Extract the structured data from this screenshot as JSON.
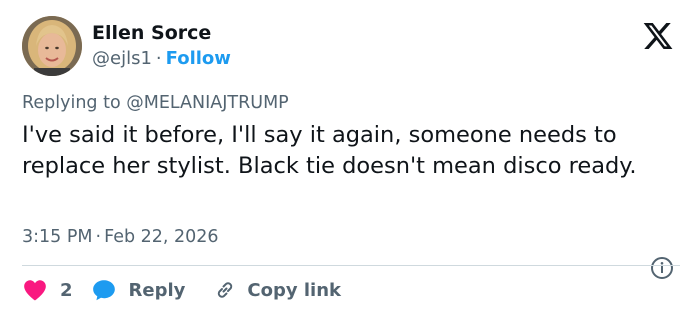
{
  "author": {
    "name": "Ellen Sorce",
    "handle": "@ejls1",
    "separator": "·",
    "follow_label": "Follow"
  },
  "reply_context": {
    "prefix": "Replying to",
    "mention": "@MELANIAJTRUMP"
  },
  "tweet": {
    "text": "I've said it before, I'll say it again, someone needs to replace her stylist. Black tie doesn't mean disco ready.",
    "time": "3:15 PM",
    "separator": "·",
    "date": "Feb 22, 2026"
  },
  "actions": {
    "like_count": "2",
    "reply_label": "Reply",
    "copy_link_label": "Copy link"
  },
  "icons": {
    "brand": "x-logo-icon",
    "info": "info-icon",
    "like": "heart-icon",
    "reply": "speech-bubble-icon",
    "copy": "link-icon"
  },
  "colors": {
    "link_blue": "#1d9bf0",
    "heart_pink": "#f91880",
    "text_primary": "#0f1419",
    "text_secondary": "#536471",
    "divider": "#cfd9de"
  }
}
